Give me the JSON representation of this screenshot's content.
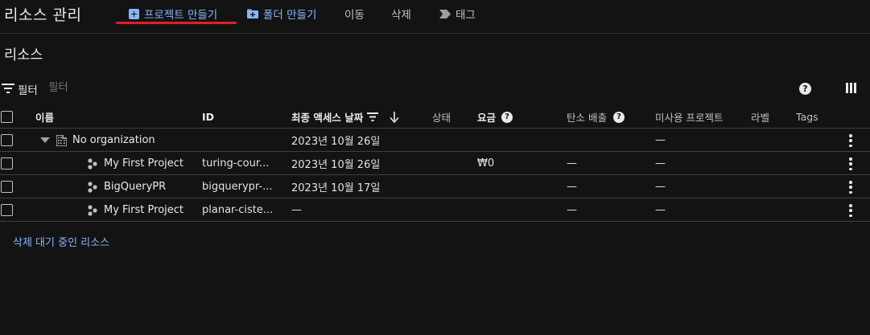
{
  "app": {
    "title": "리소스 관리"
  },
  "toolbar": {
    "create_project": "프로젝트 만들기",
    "create_folder": "폴더 만들기",
    "move": "이동",
    "delete": "삭제",
    "tags": "태그"
  },
  "section": {
    "title": "리소스"
  },
  "filter": {
    "label": "필터",
    "placeholder": "필터"
  },
  "table": {
    "columns": {
      "name": "이름",
      "id": "ID",
      "last_access": "최종 액세스 날짜",
      "status": "상태",
      "charges": "요금",
      "carbon": "탄소 배출",
      "unused": "미사용 프로젝트",
      "labels": "라벨",
      "tags": "Tags"
    },
    "rows": [
      {
        "name": "No organization",
        "id": "",
        "last_access": "2023년 10월 26일",
        "status": "",
        "charges": "",
        "carbon": "",
        "unused": "—",
        "type": "organization"
      },
      {
        "name": "My First Project",
        "id": "turing-cour...",
        "last_access": "2023년 10월 26일",
        "status": "",
        "charges": "₩0",
        "carbon": "—",
        "unused": "—",
        "type": "project"
      },
      {
        "name": "BigQueryPR",
        "id": "bigquerypr-...",
        "last_access": "2023년 10월 17일",
        "status": "",
        "charges": "",
        "carbon": "—",
        "unused": "—",
        "type": "project"
      },
      {
        "name": "My First Project",
        "id": "planar-ciste...",
        "last_access": "—",
        "status": "",
        "charges": "",
        "carbon": "—",
        "unused": "—",
        "type": "project"
      }
    ]
  },
  "pending_deletion": {
    "label": "삭제 대기 중인 리소스"
  },
  "colors": {
    "background": "#131314",
    "accent": "#8ab4f8",
    "highlight_underline": "#e02020"
  }
}
